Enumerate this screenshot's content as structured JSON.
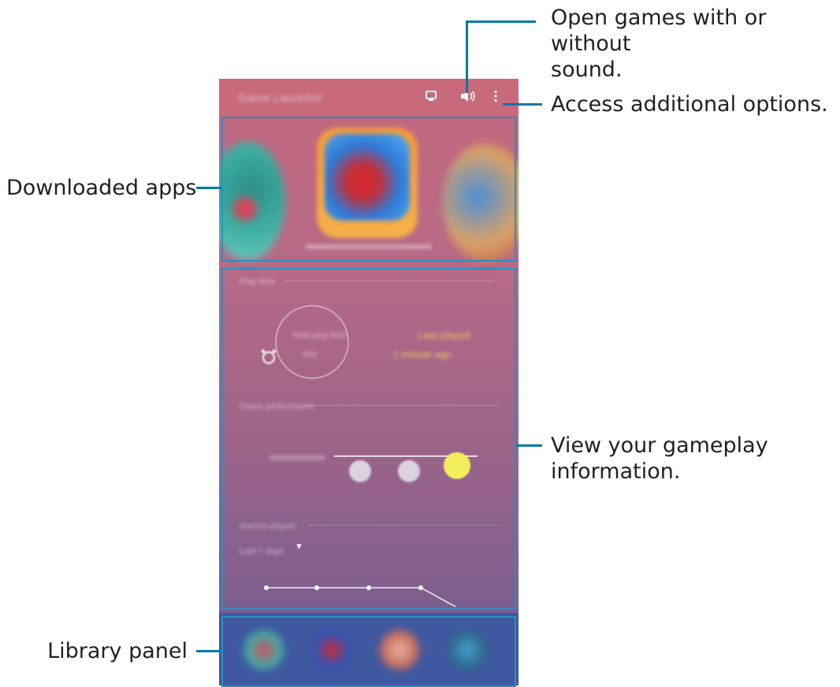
{
  "callouts": {
    "sound": "Open games with or without\nsound.",
    "options": "Access additional options.",
    "downloaded": "Downloaded apps",
    "gameplay": "View your gameplay\ninformation.",
    "library": "Library panel"
  },
  "app": {
    "title": "Game Launcher",
    "icons": {
      "library": "library-icon",
      "sound": "speaker-icon",
      "more": "more-vert-icon"
    },
    "play_time_header": "Play time",
    "play_time_label": "Total play time",
    "play_time_value": "0h0",
    "last_played_label": "Last played",
    "last_played_value": "1 minute ago",
    "performance_header": "Game performance",
    "screenshots_header": "Games played",
    "period_select": "Last 7 days",
    "accent_color": "#f3ef5a",
    "highlight_color": "#2a8fc0"
  }
}
